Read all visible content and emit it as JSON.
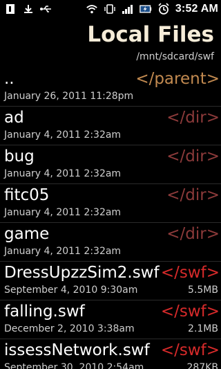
{
  "status_bar": {
    "time": "3:52 AM",
    "icons_left": [
      "sim-card-icon",
      "download-icon",
      "usb-icon"
    ],
    "icons_right": [
      "wifi-icon",
      "vibrate-icon",
      "signal-icon",
      "battery-charging-icon",
      "alarm-icon"
    ]
  },
  "header": {
    "title": "Local Files",
    "path": "/mnt/sdcard/swf"
  },
  "colors": {
    "background": "#000000",
    "title": "#f6ecd8",
    "parent_tag": "#c28a50",
    "dir_tag": "#8c3a3a",
    "swf_tag": "#d62a2a"
  },
  "files": [
    {
      "name": "..",
      "tag": "</parent>",
      "date": "January 26, 2011 11:28pm",
      "size": "",
      "kind": "parent"
    },
    {
      "name": "ad",
      "tag": "</dir>",
      "date": "January 4, 2011 2:32am",
      "size": "",
      "kind": "dir"
    },
    {
      "name": "bug",
      "tag": "</dir>",
      "date": "January 4, 2011 2:32am",
      "size": "",
      "kind": "dir"
    },
    {
      "name": "fitc05",
      "tag": "</dir>",
      "date": "January 4, 2011 2:32am",
      "size": "",
      "kind": "dir"
    },
    {
      "name": "game",
      "tag": "</dir>",
      "date": "January 4, 2011 2:32am",
      "size": "",
      "kind": "dir"
    },
    {
      "name": "DressUpzzSim2.swf",
      "tag": "</swf>",
      "date": "September 4, 2010 9:30am",
      "size": "5.5MB",
      "kind": "swf"
    },
    {
      "name": "falling.swf",
      "tag": "</swf>",
      "date": "December 2, 2010 3:38am",
      "size": "2.1MB",
      "kind": "swf"
    },
    {
      "name": "issessNetwork.swf",
      "tag": "</swf>",
      "date": "September 30, 2010 2:54am",
      "size": "287KB",
      "kind": "swf"
    }
  ]
}
